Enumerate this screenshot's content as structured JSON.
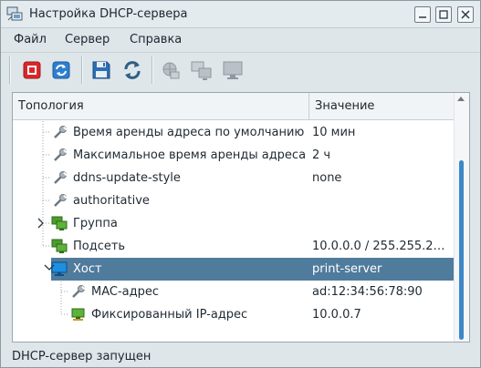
{
  "window": {
    "title": "Настройка DHCP-сервера"
  },
  "menu": [
    "Файл",
    "Сервер",
    "Справка"
  ],
  "toolbar": {
    "buttons": [
      "stop-icon",
      "restart-icon",
      "save-icon",
      "reload-icon",
      "add-group-icon",
      "add-subnet-icon",
      "add-host-icon"
    ]
  },
  "tree": {
    "columns": [
      "Топология",
      "Значение"
    ],
    "rows": [
      {
        "name": "Время аренды адреса по умолчанию",
        "value": "10 мин",
        "icon": "wrench-icon",
        "selected": false
      },
      {
        "name": "Максимальное время аренды адреса",
        "value": "2 ч",
        "icon": "wrench-icon",
        "selected": false
      },
      {
        "name": "ddns-update-style",
        "value": "none",
        "icon": "wrench-icon",
        "selected": false
      },
      {
        "name": "authoritative",
        "value": "",
        "icon": "wrench-icon",
        "selected": false
      },
      {
        "name": "Группа",
        "value": "",
        "icon": "group-icon",
        "selected": false,
        "expander": "collapsed"
      },
      {
        "name": "Подсеть",
        "value": "10.0.0.0 / 255.255.2…",
        "icon": "subnet-icon",
        "selected": false
      },
      {
        "name": "Хост",
        "value": "print-server",
        "icon": "host-icon",
        "selected": true,
        "expander": "expanded"
      },
      {
        "name": "MAC-адрес",
        "value": "ad:12:34:56:78:90",
        "icon": "wrench-icon",
        "selected": false
      },
      {
        "name": "Фиксированный IP-адрес",
        "value": "10.0.0.7",
        "icon": "fixed-ip-icon",
        "selected": false
      }
    ]
  },
  "status": "DHCP-сервер запущен",
  "colors": {
    "selection": "#4f7b9c",
    "accent": "#3d88c7",
    "stop": "#d8282c"
  }
}
